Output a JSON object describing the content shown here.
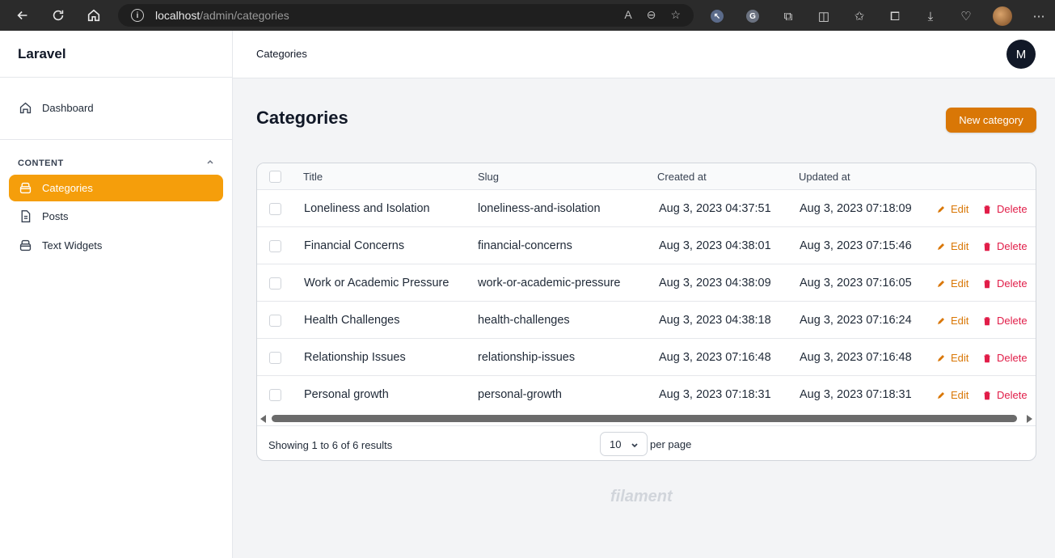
{
  "browser": {
    "url_host": "localhost",
    "url_path": "/admin/categories"
  },
  "sidebar": {
    "brand": "Laravel",
    "dashboard_label": "Dashboard",
    "group_label": "CONTENT",
    "items": [
      {
        "label": "Categories",
        "icon": "archive-box-icon",
        "active": true
      },
      {
        "label": "Posts",
        "icon": "document-icon",
        "active": false
      },
      {
        "label": "Text Widgets",
        "icon": "archive-box-icon",
        "active": false
      }
    ]
  },
  "topbar": {
    "breadcrumb": "Categories",
    "avatar_initial": "M"
  },
  "main": {
    "title": "Categories",
    "new_button": "New category",
    "table": {
      "headers": [
        "Title",
        "Slug",
        "Created at",
        "Updated at"
      ],
      "edit_label": "Edit",
      "delete_label": "Delete",
      "rows": [
        {
          "title": "Loneliness and Isolation",
          "slug": "loneliness-and-isolation",
          "created": "Aug 3, 2023 04:37:51",
          "updated": "Aug 3, 2023 07:18:09"
        },
        {
          "title": "Financial Concerns",
          "slug": "financial-concerns",
          "created": "Aug 3, 2023 04:38:01",
          "updated": "Aug 3, 2023 07:15:46"
        },
        {
          "title": "Work or Academic Pressure",
          "slug": "work-or-academic-pressure",
          "created": "Aug 3, 2023 04:38:09",
          "updated": "Aug 3, 2023 07:16:05"
        },
        {
          "title": "Health Challenges",
          "slug": "health-challenges",
          "created": "Aug 3, 2023 04:38:18",
          "updated": "Aug 3, 2023 07:16:24"
        },
        {
          "title": "Relationship Issues",
          "slug": "relationship-issues",
          "created": "Aug 3, 2023 07:16:48",
          "updated": "Aug 3, 2023 07:16:48"
        },
        {
          "title": "Personal growth",
          "slug": "personal-growth",
          "created": "Aug 3, 2023 07:18:31",
          "updated": "Aug 3, 2023 07:18:31"
        }
      ],
      "showing_text": "Showing 1 to 6 of 6 results",
      "per_page_value": "10",
      "per_page_label": "per page"
    },
    "footer_brand": "filament"
  },
  "colors": {
    "accent": "#f59e0b",
    "button": "#d97706",
    "danger": "#e11d48"
  }
}
